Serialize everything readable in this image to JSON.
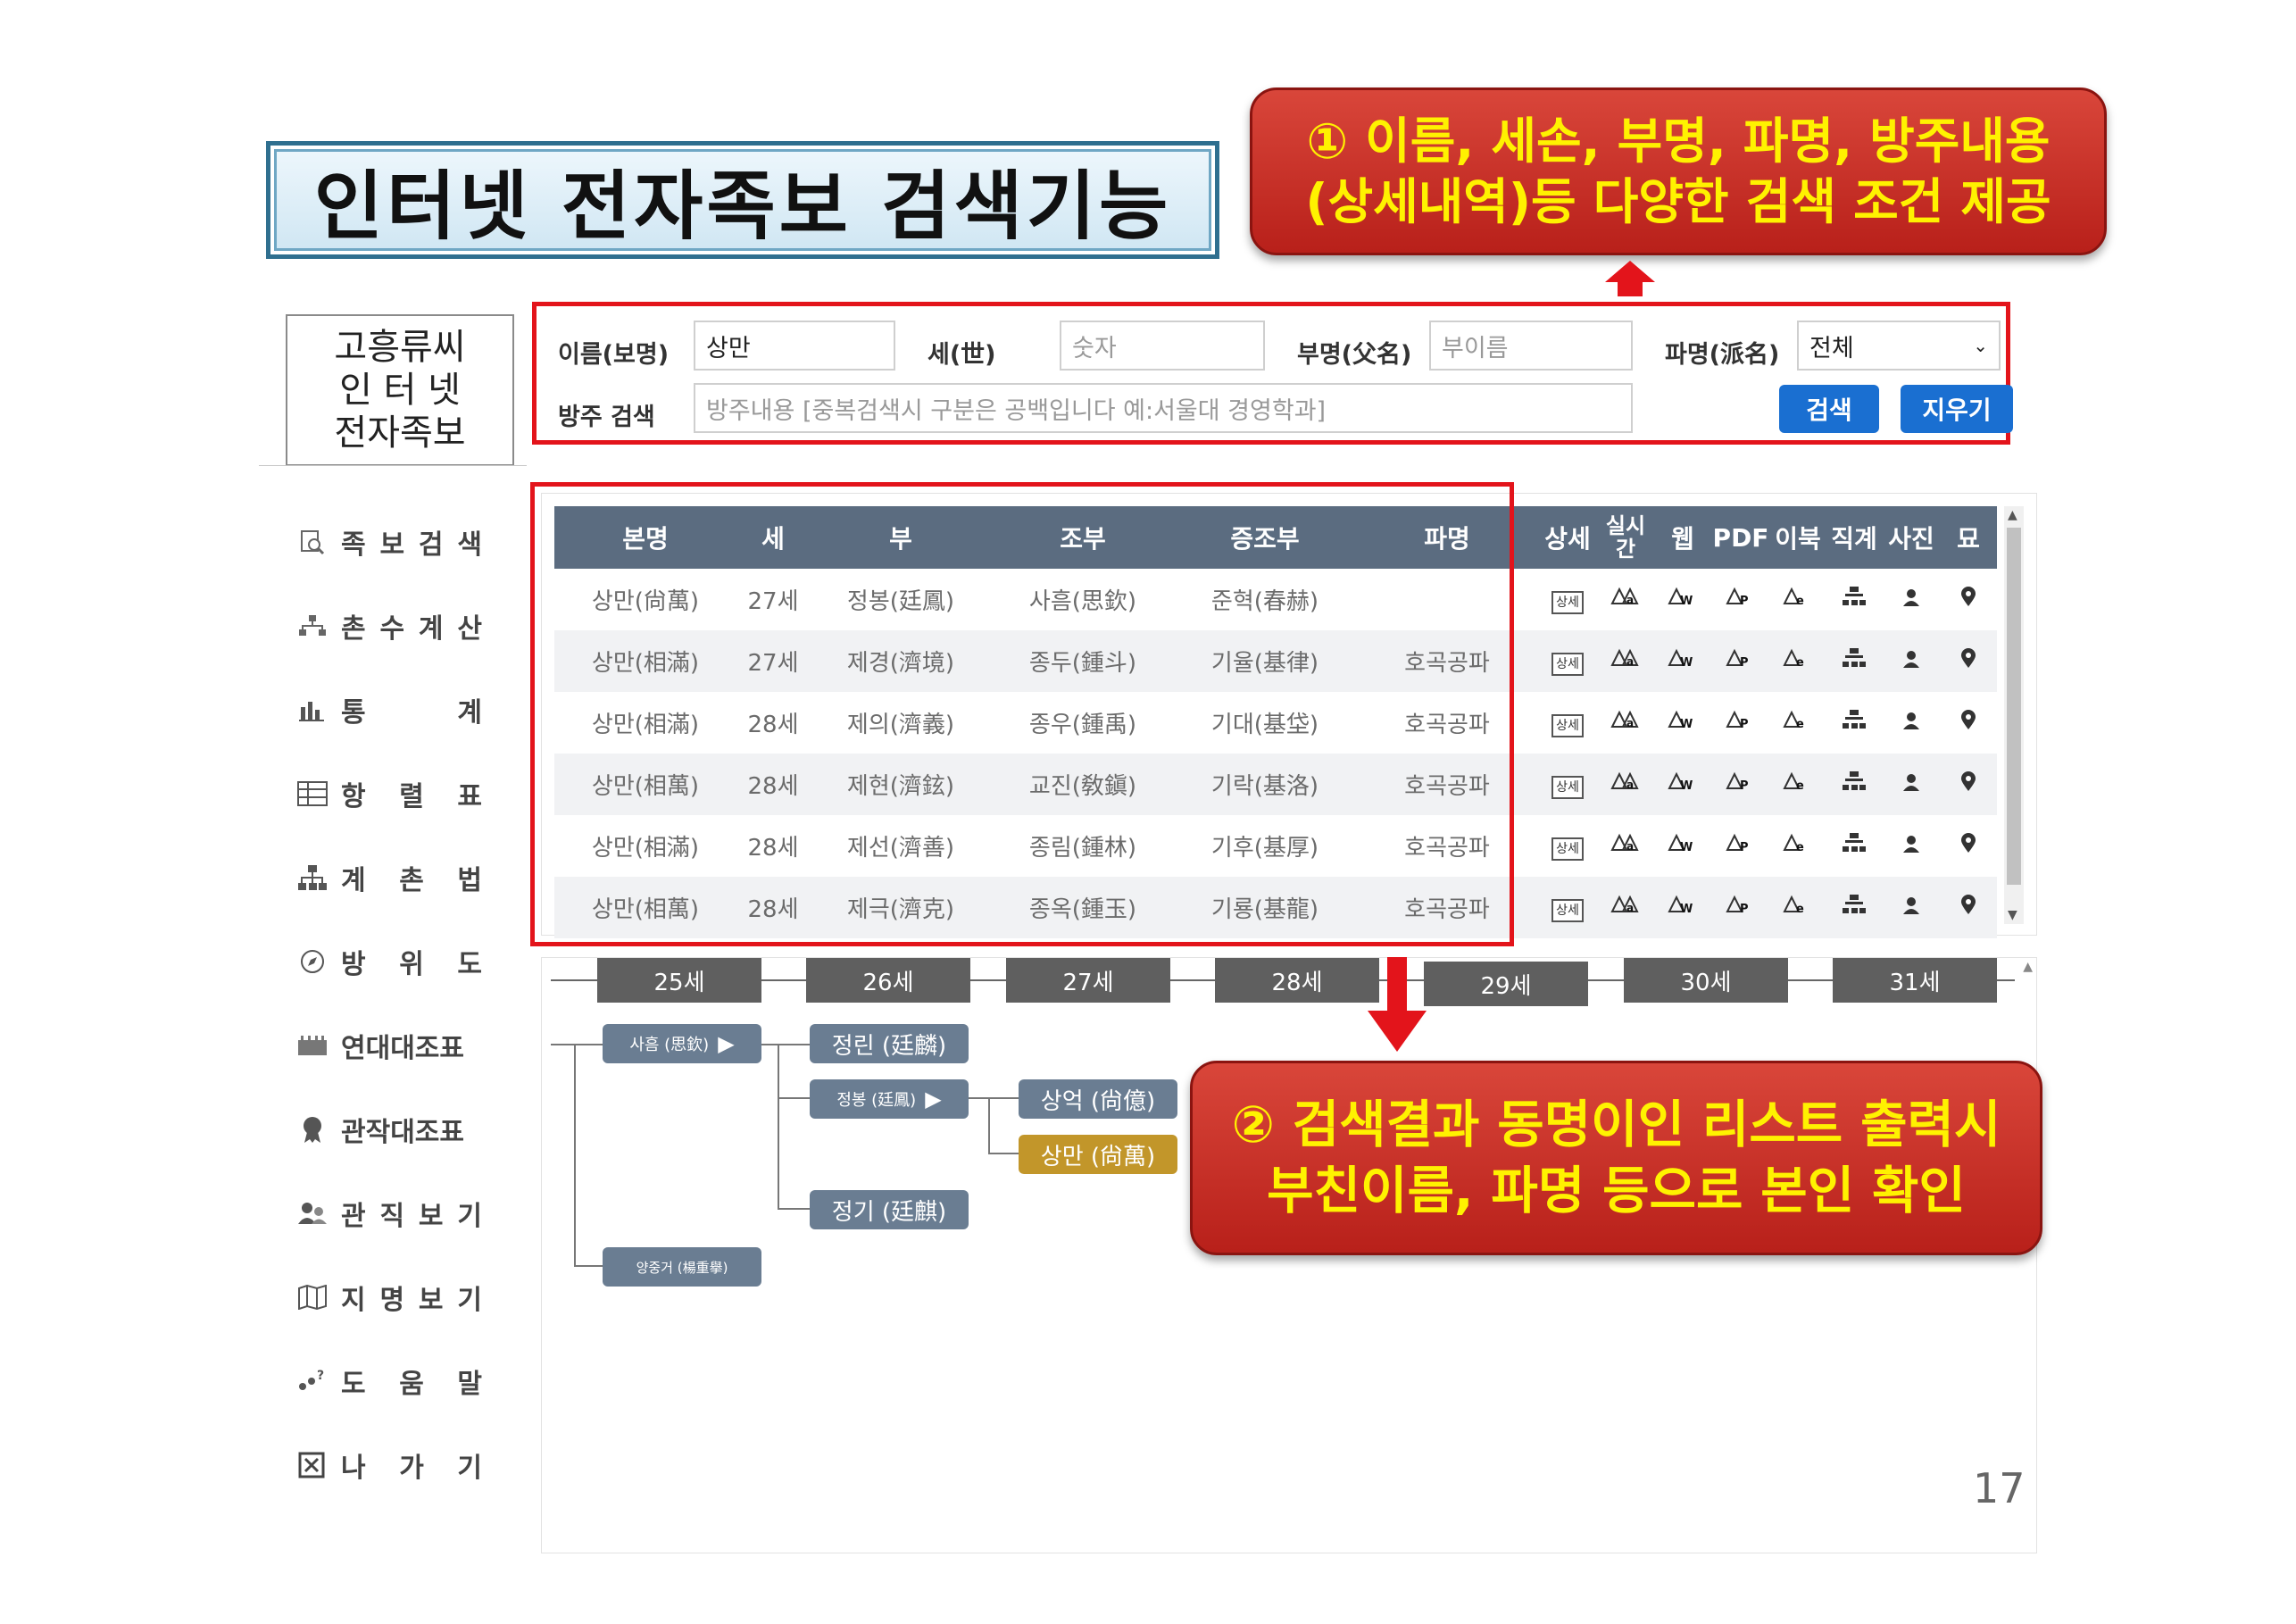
{
  "title": "인터넷 전자족보 검색기능",
  "callouts": {
    "first": [
      "① 이름, 세손, 부명, 파명, 방주내용",
      "(상세내역)등 다양한 검색 조건 제공"
    ],
    "second": [
      "② 검색결과 동명이인 리스트 출력시",
      "부친이름, 파명 등으로 본인 확인"
    ]
  },
  "logo": [
    "고흥류씨",
    "인 터 넷",
    "전자족보"
  ],
  "sidebar": [
    {
      "icon": "magnifier-icon",
      "label": "족보검색"
    },
    {
      "icon": "hierarchy-icon",
      "label": "촌수계산"
    },
    {
      "icon": "bar-chart-icon",
      "label": "통계"
    },
    {
      "icon": "table-icon",
      "label": "항렬표"
    },
    {
      "icon": "org-chart-icon",
      "label": "계촌법"
    },
    {
      "icon": "compass-icon",
      "label": "방위도"
    },
    {
      "icon": "calendar-icon",
      "label": "연대대조표"
    },
    {
      "icon": "medal-icon",
      "label": "관작대조표"
    },
    {
      "icon": "people-icon",
      "label": "관직보기"
    },
    {
      "icon": "map-icon",
      "label": "지명보기"
    },
    {
      "icon": "help-icon",
      "label": "도움말"
    },
    {
      "icon": "exit-icon",
      "label": "나가기"
    }
  ],
  "search": {
    "name_label": "이름(보명)",
    "name_value": "상만",
    "gen_label": "세(世)",
    "gen_placeholder": "숫자",
    "father_label": "부명(父名)",
    "father_placeholder": "부이름",
    "branch_label": "파명(派名)",
    "branch_value": "전체",
    "note_label": "방주 검색",
    "note_placeholder": "방주내용 [중복검색시 구분은 공백입니다 예:서울대 경영학과]",
    "search_button": "검색",
    "clear_button": "지우기"
  },
  "table": {
    "headers": [
      "본명",
      "세",
      "부",
      "조부",
      "증조부",
      "파명",
      "상세",
      "실시간",
      "웹",
      "PDF",
      "이북",
      "직계",
      "사진",
      "묘"
    ],
    "rows": [
      [
        "상만(尙萬)",
        "27세",
        "정봉(廷鳳)",
        "사흠(思欽)",
        "준혁(春赫)",
        ""
      ],
      [
        "상만(相滿)",
        "27세",
        "제경(濟境)",
        "종두(鍾斗)",
        "기율(基律)",
        "호곡공파"
      ],
      [
        "상만(相滿)",
        "28세",
        "제의(濟義)",
        "종우(鍾禹)",
        "기대(基垈)",
        "호곡공파"
      ],
      [
        "상만(相萬)",
        "28세",
        "제현(濟鉉)",
        "교진(敎鎭)",
        "기락(基洛)",
        "호곡공파"
      ],
      [
        "상만(相滿)",
        "28세",
        "제선(濟善)",
        "종림(鍾林)",
        "기후(基厚)",
        "호곡공파"
      ],
      [
        "상만(相萬)",
        "28세",
        "제극(濟克)",
        "종옥(鍾玉)",
        "기룡(基龍)",
        "호곡공파"
      ]
    ],
    "detail_tag": "상세",
    "action_icons": [
      "realtime-book-icon",
      "web-book-icon",
      "pdf-book-icon",
      "ebook-icon",
      "lineage-icon",
      "photo-person-icon",
      "grave-pin-icon"
    ]
  },
  "tree": {
    "generations": [
      "25세",
      "26세",
      "27세",
      "28세",
      "29세",
      "30세",
      "31세"
    ],
    "nodes": {
      "sa_heum": "사흠 (思欽)",
      "yang_jung": "양중거 (楊重擧)",
      "jeong_rin": "정린 (廷麟)",
      "jeong_bong": "정봉 (廷鳳)",
      "jeong_gi": "정기 (廷麒)",
      "sang_eok": "상억 (尙億)",
      "sang_man": "상만 (尙萬)"
    }
  },
  "page_number": "17",
  "colors": {
    "accent_red": "#e3141b",
    "callout_text": "#fff200",
    "button_blue": "#1a6fd1",
    "header_slate": "#5b6c80",
    "highlight_gold": "#c2962a"
  }
}
